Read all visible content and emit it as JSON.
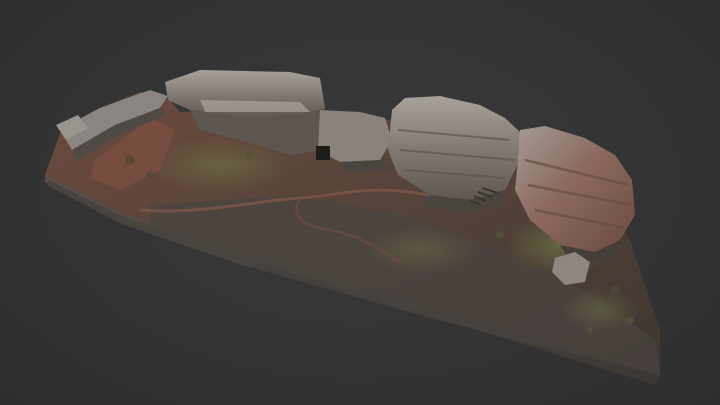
{
  "scene": {
    "background_color": "#333333",
    "subject": "3d-rock-terrain-model"
  },
  "palette": {
    "soil_dark": "#4a3a30",
    "soil_red": "#7a4b3a",
    "moss": "#5c5a3a",
    "rock_light": "#9c9690",
    "rock_mid": "#7a736c",
    "rock_dark": "#4f4a45",
    "rock_red": "#8a5a4a",
    "base_side": "#55504a",
    "path": "#6b4a40"
  }
}
